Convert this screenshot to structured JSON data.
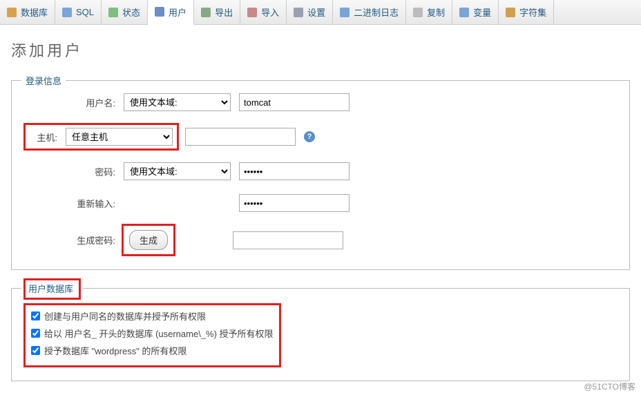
{
  "tabs": {
    "database": "数据库",
    "sql": "SQL",
    "status": "状态",
    "users": "用户",
    "export": "导出",
    "import": "导入",
    "settings": "设置",
    "binlog": "二进制日志",
    "replication": "复制",
    "variables": "变量",
    "charsets": "字符集"
  },
  "page_title": "添加用户",
  "login_section": {
    "legend": "登录信息",
    "username_label": "用户名:",
    "username_mode": "使用文本域:",
    "username_value": "tomcat",
    "host_label": "主机:",
    "host_mode": "任意主机",
    "host_value": "",
    "password_label": "密码:",
    "password_mode": "使用文本域:",
    "password_value": "••••••",
    "retype_label": "重新输入:",
    "retype_value": "••••••",
    "generate_label": "生成密码:",
    "generate_btn": "生成",
    "generate_value": ""
  },
  "db_section": {
    "legend": "用户数据库",
    "check1": "创建与用户同名的数据库并授予所有权限",
    "check2": "给以 用户名_ 开头的数据库 (username\\_%) 授予所有权限",
    "check3": "授予数据库 \"wordpress\" 的所有权限"
  },
  "watermark": "@51CTO博客"
}
